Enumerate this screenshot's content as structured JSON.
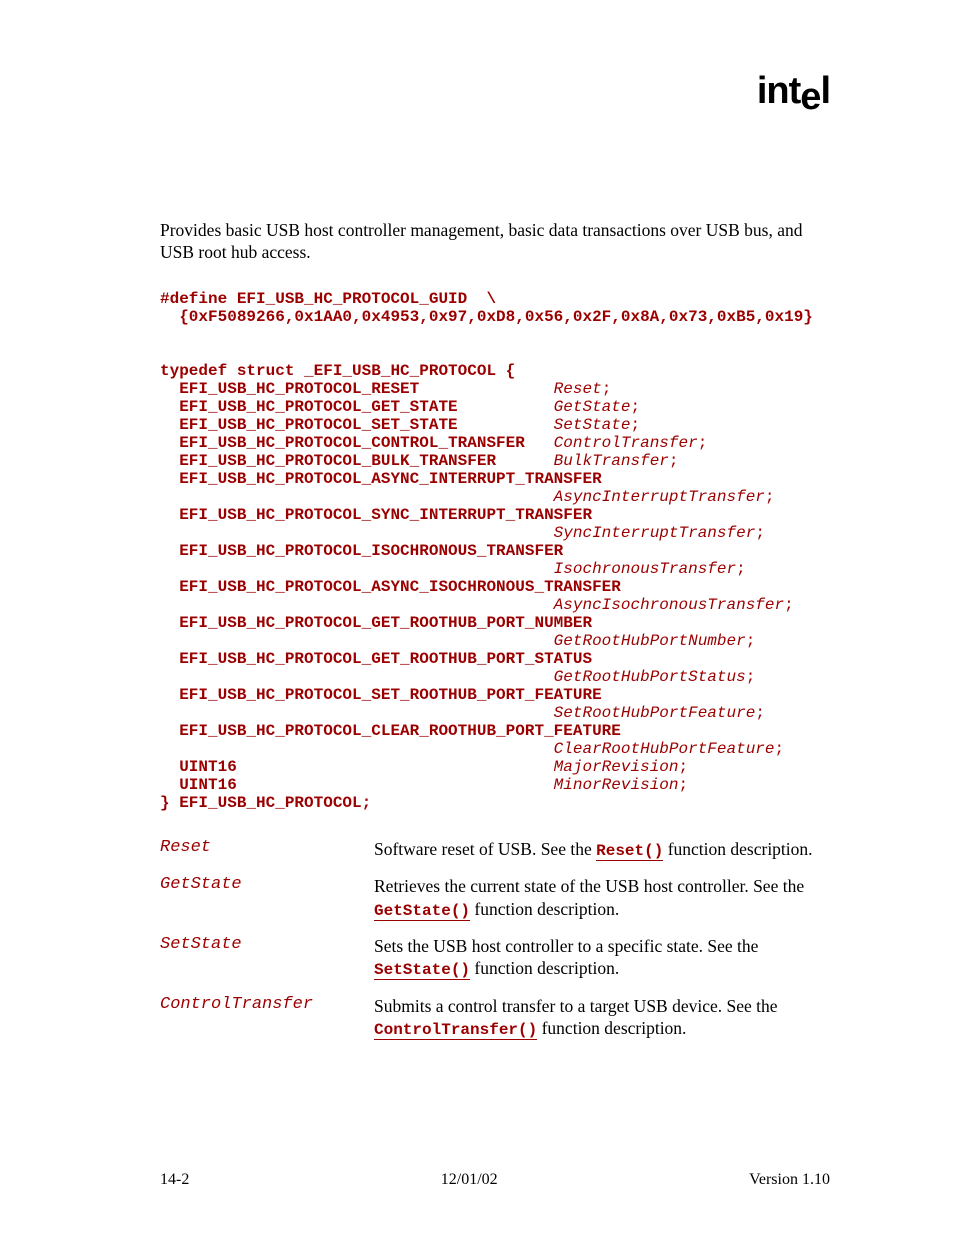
{
  "logo": {
    "part1": "int",
    "part2": "e",
    "part3": "l"
  },
  "summary": "Provides basic USB host controller management, basic data transactions over USB bus, and USB root hub access.",
  "code": {
    "l1": "#define EFI_USB_HC_PROTOCOL_GUID  \\",
    "l2": "  {0xF5089266,0x1AA0,0x4953,0x97,0xD8,0x56,0x2F,0x8A,0x73,0xB5,0x19}",
    "l3": "typedef struct _EFI_USB_HC_PROTOCOL {",
    "m1t": "  EFI_USB_HC_PROTOCOL_RESET              ",
    "m1v": "Reset",
    "m1s": ";",
    "m2t": "  EFI_USB_HC_PROTOCOL_GET_STATE          ",
    "m2v": "GetState",
    "m2s": ";",
    "m3t": "  EFI_USB_HC_PROTOCOL_SET_STATE          ",
    "m3v": "SetState",
    "m3s": ";",
    "m4t": "  EFI_USB_HC_PROTOCOL_CONTROL_TRANSFER   ",
    "m4v": "ControlTransfer",
    "m4s": ";",
    "m5t": "  EFI_USB_HC_PROTOCOL_BULK_TRANSFER      ",
    "m5v": "BulkTransfer",
    "m5s": ";",
    "m6t": "  EFI_USB_HC_PROTOCOL_ASYNC_INTERRUPT_TRANSFER",
    "m6p": "                                         ",
    "m6v": "AsyncInterruptTransfer",
    "m6s": ";",
    "m7t": "  EFI_USB_HC_PROTOCOL_SYNC_INTERRUPT_TRANSFER",
    "m7p": "                                         ",
    "m7v": "SyncInterruptTransfer",
    "m7s": ";",
    "m8t": "  EFI_USB_HC_PROTOCOL_ISOCHRONOUS_TRANSFER",
    "m8p": "                                         ",
    "m8v": "IsochronousTransfer",
    "m8s": ";",
    "m9t": "  EFI_USB_HC_PROTOCOL_ASYNC_ISOCHRONOUS_TRANSFER",
    "m9p": "                                         ",
    "m9v": "AsyncIsochronousTransfer",
    "m9s": ";",
    "m10t": "  EFI_USB_HC_PROTOCOL_GET_ROOTHUB_PORT_NUMBER",
    "m10p": "                                         ",
    "m10v": "GetRootHubPortNumber",
    "m10s": ";",
    "m11t": "  EFI_USB_HC_PROTOCOL_GET_ROOTHUB_PORT_STATUS",
    "m11p": "                                         ",
    "m11v": "GetRootHubPortStatus",
    "m11s": ";",
    "m12t": "  EFI_USB_HC_PROTOCOL_SET_ROOTHUB_PORT_FEATURE",
    "m12p": "                                         ",
    "m12v": "SetRootHubPortFeature",
    "m12s": ";",
    "m13t": "  EFI_USB_HC_PROTOCOL_CLEAR_ROOTHUB_PORT_FEATURE",
    "m13p": "                                         ",
    "m13v": "ClearRootHubPortFeature",
    "m13s": ";",
    "m14t": "  UINT16                                 ",
    "m14v": "MajorRevision",
    "m14s": ";",
    "m15t": "  UINT16                                 ",
    "m15v": "MinorRevision",
    "m15s": ";",
    "l4": "} EFI_USB_HC_PROTOCOL;"
  },
  "params": [
    {
      "name": "Reset",
      "pre": "Software reset of USB.  See the ",
      "fn": "Reset()",
      "post": " function description."
    },
    {
      "name": "GetState",
      "pre": "Retrieves the current state of the USB host controller.  See the ",
      "fn": "GetState()",
      "post": " function description."
    },
    {
      "name": "SetState",
      "pre": "Sets the USB host controller to a specific state.  See the ",
      "fn": "SetState()",
      "post": " function description."
    },
    {
      "name": "ControlTransfer",
      "pre": "Submits a control transfer to a target USB device.  See the ",
      "fn": "ControlTransfer()",
      "post": " function description."
    }
  ],
  "footer": {
    "left": "14-2",
    "center": "12/01/02",
    "right": "Version 1.10"
  }
}
